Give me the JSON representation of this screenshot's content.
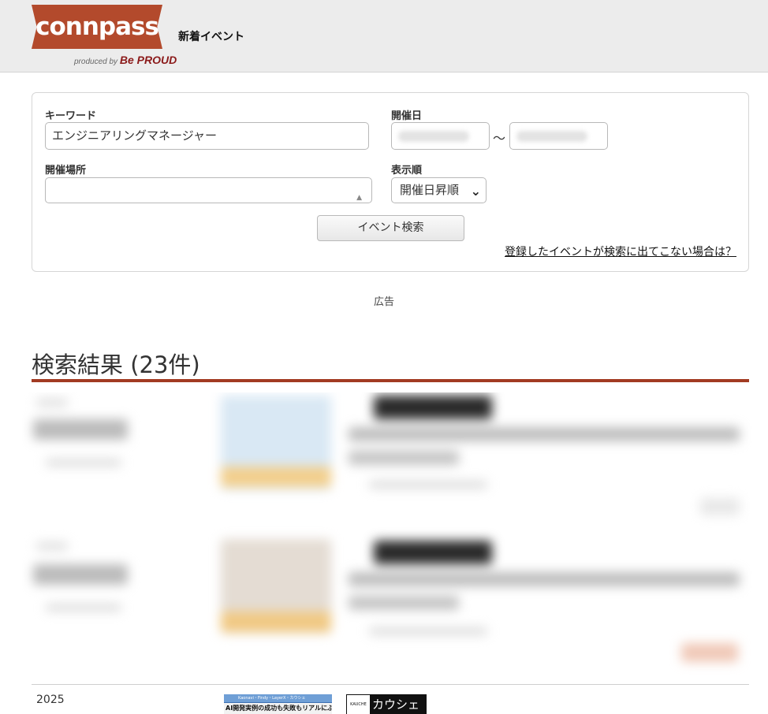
{
  "header": {
    "logo_text": "connpass",
    "logo_sub": "produced by",
    "logo_sub_brand": "Be PROUD",
    "nav_link": "新着イベント"
  },
  "search": {
    "keyword_label": "キーワード",
    "keyword_value": "エンジニアリングマネージャー",
    "date_label": "開催日",
    "date_separator": "〜",
    "place_label": "開催場所",
    "order_label": "表示順",
    "order_value": "開催日昇順",
    "submit_label": "イベント検索",
    "help_link": "登録したイベントが検索に出てこない場合は？"
  },
  "ad_label": "広告",
  "results": {
    "title": "検索結果 (23件)"
  },
  "footer": {
    "year": "2025",
    "ad1_top": "Kaonavi・Findy・LayerX・カウシェ",
    "ad1_text": "AI開発実例の成功も失敗もリアルにぶっちゃけます",
    "ad2_logo": "KAUCHE",
    "ad2_text": "カウシェ"
  },
  "colors": {
    "brand": "#b34a2c",
    "results_rule": "#a23b22",
    "header_bg": "#ececec"
  }
}
